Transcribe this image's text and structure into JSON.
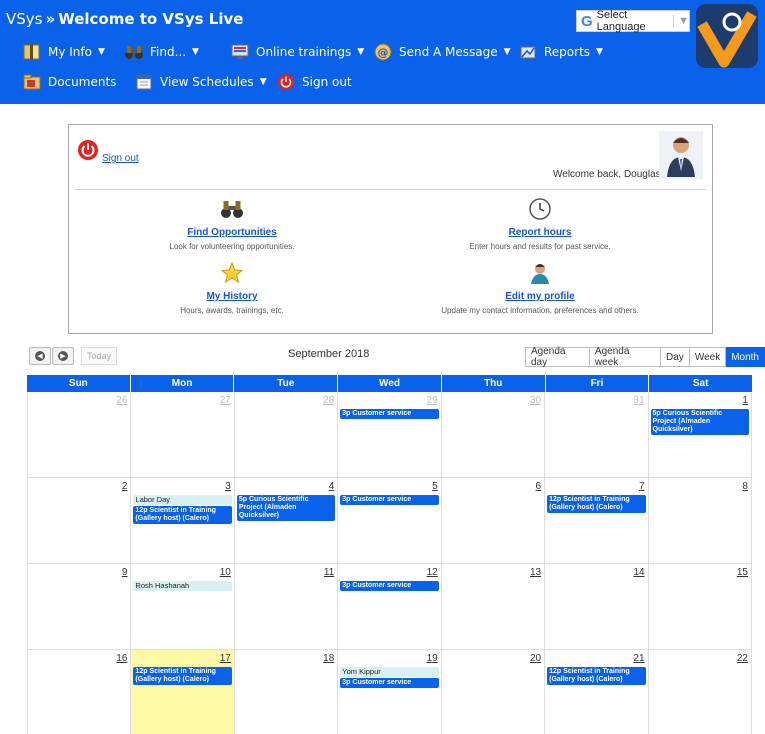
{
  "header": {
    "site": "VSys",
    "separator": "»",
    "welcome": "Welcome to VSys Live",
    "nav": [
      {
        "label": "My Info",
        "has_caret": true,
        "icon": "book-icon"
      },
      {
        "label": "Find...",
        "has_caret": true,
        "icon": "binoculars-icon"
      },
      {
        "label": "Online trainings",
        "has_caret": true,
        "icon": "monitor-icon"
      },
      {
        "label": "Send A Message",
        "has_caret": true,
        "icon": "at-sign-icon"
      },
      {
        "label": "Reports",
        "has_caret": true,
        "icon": "reports-icon"
      },
      {
        "label": "Documents",
        "has_caret": false,
        "icon": "folder-icon"
      },
      {
        "label": "View Schedules",
        "has_caret": true,
        "icon": "calendar-icon"
      },
      {
        "label": "Sign out",
        "has_caret": false,
        "icon": "power-icon"
      }
    ],
    "language": {
      "label": "Select Language",
      "caret": "▼",
      "g": "G"
    }
  },
  "panel": {
    "sign_out": "Sign out",
    "welcome_back": "Welcome back, Douglas.",
    "features": [
      {
        "title": "Find Opportunities",
        "desc": "Look for volunteering opportunities.",
        "icon": "binoculars-icon"
      },
      {
        "title": "Report hours",
        "desc": "Enter hours and results for past service.",
        "icon": "clock-icon"
      },
      {
        "title": "My History",
        "desc": "Hours, awards, trainings, etc.",
        "icon": "star-icon"
      },
      {
        "title": "Edit my profile",
        "desc": "Update my contact information, preferences and others.",
        "icon": "user-icon"
      }
    ]
  },
  "calendar": {
    "title": "September 2018",
    "today_label": "Today",
    "views": [
      "Agenda day",
      "Agenda week",
      "Day",
      "Week",
      "Month"
    ],
    "active_view": "Month",
    "days_of_week": [
      "Sun",
      "Mon",
      "Tue",
      "Wed",
      "Thu",
      "Fri",
      "Sat"
    ],
    "weeks": [
      [
        {
          "num": "26",
          "other": true,
          "events": []
        },
        {
          "num": "27",
          "other": true,
          "events": []
        },
        {
          "num": "28",
          "other": true,
          "events": []
        },
        {
          "num": "29",
          "other": true,
          "events": [
            {
              "time": "3p",
              "text": "Customer service"
            }
          ]
        },
        {
          "num": "30",
          "other": true,
          "events": []
        },
        {
          "num": "31",
          "other": true,
          "events": []
        },
        {
          "num": "1",
          "other": false,
          "events": [
            {
              "time": "5p",
              "text": "Curious Scientific Project (Almaden Quicksilver)"
            }
          ]
        }
      ],
      [
        {
          "num": "2",
          "other": false,
          "events": []
        },
        {
          "num": "3",
          "other": false,
          "events": [
            {
              "holiday": "Labor Day"
            },
            {
              "time": "12p",
              "text": "Scientist in Training (Gallery host) (Calero)"
            }
          ]
        },
        {
          "num": "4",
          "other": false,
          "events": [
            {
              "time": "5p",
              "text": "Curious Scientific Project (Almaden Quicksilver)"
            }
          ]
        },
        {
          "num": "5",
          "other": false,
          "events": [
            {
              "time": "3p",
              "text": "Customer service"
            }
          ]
        },
        {
          "num": "6",
          "other": false,
          "events": []
        },
        {
          "num": "7",
          "other": false,
          "events": [
            {
              "time": "12p",
              "text": "Scientist in Training (Gallery host) (Calero)"
            }
          ]
        },
        {
          "num": "8",
          "other": false,
          "events": []
        }
      ],
      [
        {
          "num": "9",
          "other": false,
          "events": []
        },
        {
          "num": "10",
          "other": false,
          "events": [
            {
              "holiday": "Rosh Hashanah"
            }
          ]
        },
        {
          "num": "11",
          "other": false,
          "events": []
        },
        {
          "num": "12",
          "other": false,
          "events": [
            {
              "time": "3p",
              "text": "Customer service"
            }
          ]
        },
        {
          "num": "13",
          "other": false,
          "events": []
        },
        {
          "num": "14",
          "other": false,
          "events": []
        },
        {
          "num": "15",
          "other": false,
          "events": []
        }
      ],
      [
        {
          "num": "16",
          "other": false,
          "events": []
        },
        {
          "num": "17",
          "other": false,
          "today": true,
          "events": [
            {
              "time": "12p",
              "text": "Scientist in Training (Gallery host) (Calero)"
            }
          ]
        },
        {
          "num": "18",
          "other": false,
          "events": []
        },
        {
          "num": "19",
          "other": false,
          "events": [
            {
              "holiday": "Yom Kippur"
            },
            {
              "time": "3p",
              "text": "Customer service"
            }
          ]
        },
        {
          "num": "20",
          "other": false,
          "events": []
        },
        {
          "num": "21",
          "other": false,
          "events": [
            {
              "time": "12p",
              "text": "Scientist in Training (Gallery host) (Calero)"
            }
          ]
        },
        {
          "num": "22",
          "other": false,
          "events": []
        }
      ]
    ]
  },
  "colors": {
    "brand": "#0a62ea",
    "today": "#fcf8a6",
    "holiday": "#d8f0f2"
  }
}
